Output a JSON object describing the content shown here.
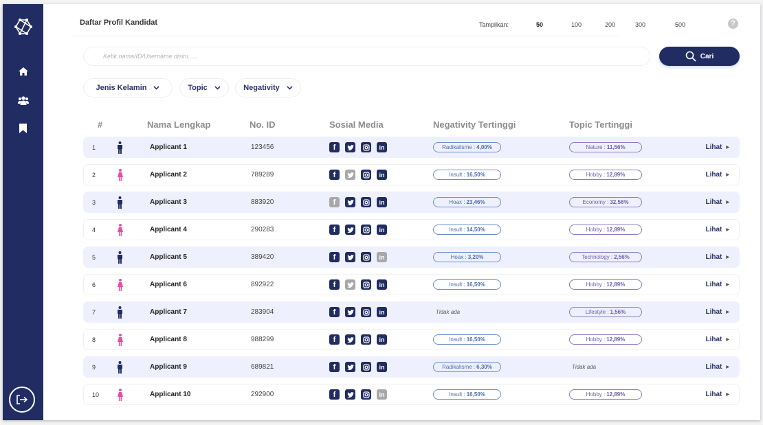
{
  "colors": {
    "primary": "#212d62",
    "row_alt": "#eef1fd",
    "male": "#212d62",
    "female": "#e64da7",
    "inactive": "#a8a8a8"
  },
  "sidebar": {
    "items": [
      {
        "name": "logo",
        "icon": "network-logo-icon"
      },
      {
        "name": "home",
        "icon": "home-icon"
      },
      {
        "name": "users",
        "icon": "users-icon"
      },
      {
        "name": "bookmark",
        "icon": "bookmark-icon"
      }
    ],
    "logout_icon": "logout-icon"
  },
  "header": {
    "title": "Daftar Profil Kandidat",
    "show_label": "Tampilkan:",
    "show_options": [
      "50",
      "100",
      "200",
      "300",
      "500"
    ],
    "show_selected": "50",
    "help_label": "?"
  },
  "search": {
    "placeholder": "Ketik nama/ID/Username disini......",
    "value": "",
    "button_label": "Cari"
  },
  "filters": [
    {
      "label": "Jenis Kelamin"
    },
    {
      "label": "Topic"
    },
    {
      "label": "Negativity"
    }
  ],
  "table": {
    "headers": [
      "#",
      "Nama Lengkap",
      "No. ID",
      "Sosial Media",
      "Negativity Tertinggi",
      "Topic Tertinggi"
    ],
    "action_label": "Lihat",
    "none_label": "Tidak ada",
    "rows": [
      {
        "no": "1",
        "gender": "male",
        "name": "Applicant 1",
        "id": "123456",
        "social": {
          "facebook": true,
          "twitter": true,
          "instagram": true,
          "linkedin": true
        },
        "negativity": {
          "label": "Radikalisme :",
          "value": "4,00%"
        },
        "topic": {
          "label": "Nature :",
          "value": "11,56%"
        }
      },
      {
        "no": "2",
        "gender": "female",
        "name": "Applicant 2",
        "id": "789289",
        "social": {
          "facebook": true,
          "twitter": false,
          "instagram": true,
          "linkedin": true
        },
        "negativity": {
          "label": "Insult :",
          "value": "16,50%"
        },
        "topic": {
          "label": "Hobby :",
          "value": "12,89%"
        }
      },
      {
        "no": "3",
        "gender": "male",
        "name": "Applicant 3",
        "id": "883920",
        "social": {
          "facebook": false,
          "twitter": true,
          "instagram": true,
          "linkedin": true
        },
        "negativity": {
          "label": "Hoax :",
          "value": "23,46%"
        },
        "topic": {
          "label": "Economy :",
          "value": "32,56%"
        }
      },
      {
        "no": "4",
        "gender": "female",
        "name": "Applicant 4",
        "id": "290283",
        "social": {
          "facebook": true,
          "twitter": true,
          "instagram": true,
          "linkedin": true
        },
        "negativity": {
          "label": "Insult :",
          "value": "14,50%"
        },
        "topic": {
          "label": "Hobby :",
          "value": "12,89%"
        }
      },
      {
        "no": "5",
        "gender": "male",
        "name": "Applicant 5",
        "id": "389420",
        "social": {
          "facebook": true,
          "twitter": true,
          "instagram": true,
          "linkedin": false
        },
        "negativity": {
          "label": "Hoax :",
          "value": "3,20%"
        },
        "topic": {
          "label": "Technology :",
          "value": "2,56%"
        }
      },
      {
        "no": "6",
        "gender": "female",
        "name": "Applicant 6",
        "id": "892922",
        "social": {
          "facebook": true,
          "twitter": false,
          "instagram": true,
          "linkedin": true
        },
        "negativity": {
          "label": "Insult :",
          "value": "16,50%"
        },
        "topic": {
          "label": "Hobby :",
          "value": "12,89%"
        }
      },
      {
        "no": "7",
        "gender": "male",
        "name": "Applicant 7",
        "id": "283904",
        "social": {
          "facebook": true,
          "twitter": true,
          "instagram": true,
          "linkedin": true
        },
        "negativity": null,
        "topic": {
          "label": "Lifestyle :",
          "value": "1,56%"
        }
      },
      {
        "no": "8",
        "gender": "female",
        "name": "Applicant 8",
        "id": "988299",
        "social": {
          "facebook": true,
          "twitter": true,
          "instagram": true,
          "linkedin": true
        },
        "negativity": {
          "label": "Insult :",
          "value": "16,50%"
        },
        "topic": {
          "label": "Hobby :",
          "value": "12,89%"
        }
      },
      {
        "no": "9",
        "gender": "male",
        "name": "Applicant 9",
        "id": "689821",
        "social": {
          "facebook": true,
          "twitter": true,
          "instagram": true,
          "linkedin": true
        },
        "negativity": {
          "label": "Radikalisme :",
          "value": "6,30%"
        },
        "topic": null
      },
      {
        "no": "10",
        "gender": "female",
        "name": "Applicant 10",
        "id": "292900",
        "social": {
          "facebook": true,
          "twitter": true,
          "instagram": true,
          "linkedin": false
        },
        "negativity": {
          "label": "Insult :",
          "value": "16,50%"
        },
        "topic": {
          "label": "Hobby :",
          "value": "12,89%"
        }
      }
    ]
  }
}
